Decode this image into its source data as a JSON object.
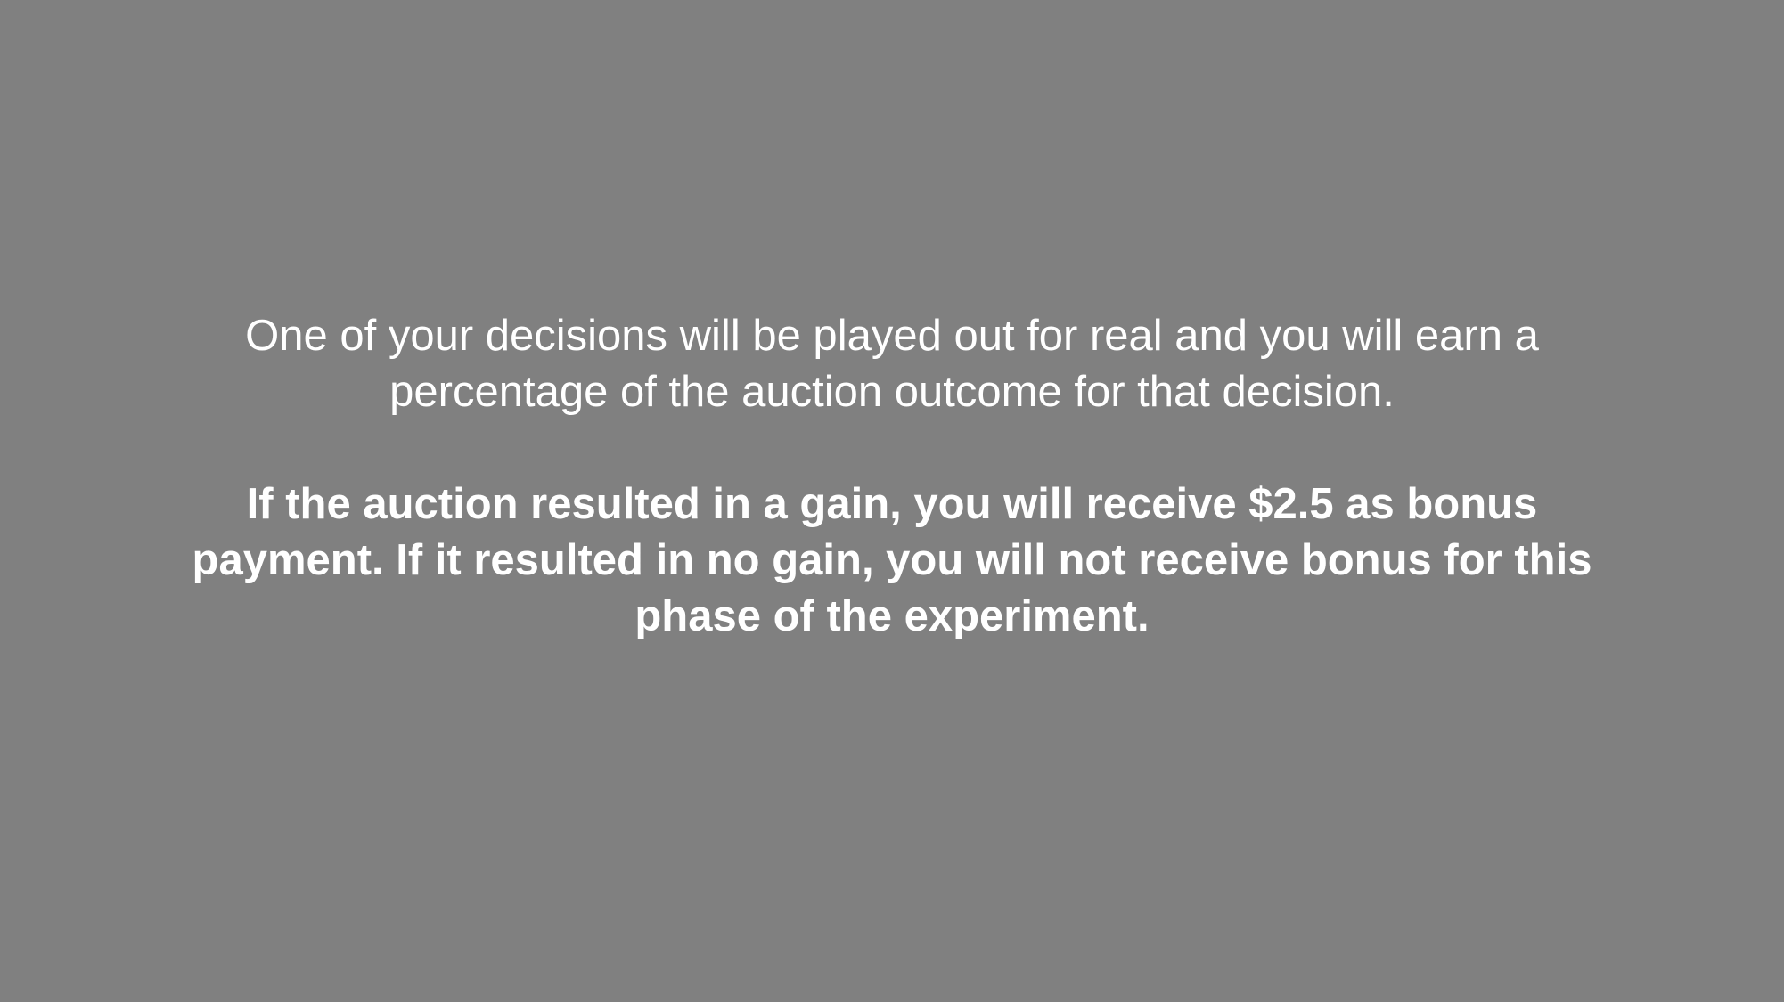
{
  "instructions": {
    "info_lines": [
      "One of your decisions will be played out for real and you will earn a",
      "percentage of the auction outcome for that decision."
    ],
    "bonus_lines": [
      "If the auction resulted in a gain, you will receive $2.5 as bonus",
      "payment. If it resulted in no gain, you will not receive bonus for this",
      "phase of the experiment."
    ]
  },
  "colors": {
    "background": "#808080",
    "text": "#ffffff"
  }
}
